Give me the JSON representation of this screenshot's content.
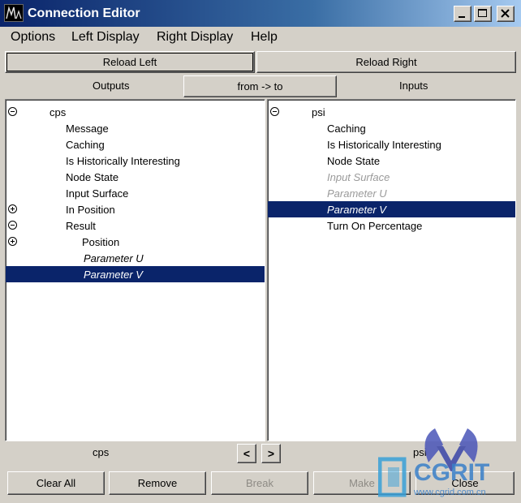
{
  "window": {
    "title": "Connection Editor"
  },
  "menu": {
    "items": [
      "Options",
      "Left Display",
      "Right Display",
      "Help"
    ]
  },
  "reload": {
    "left_label": "Reload Left",
    "right_label": "Reload Right"
  },
  "headers": {
    "outputs": "Outputs",
    "direction": "from -> to",
    "inputs": "Inputs"
  },
  "left_tree": {
    "rows": [
      {
        "label": "cps",
        "expander": "minus",
        "style": "normal",
        "selected": false
      },
      {
        "label": "Message",
        "expander": "none",
        "style": "normal",
        "selected": false
      },
      {
        "label": "Caching",
        "expander": "none",
        "style": "normal",
        "selected": false
      },
      {
        "label": "Is Historically Interesting",
        "expander": "none",
        "style": "normal",
        "selected": false
      },
      {
        "label": "Node State",
        "expander": "none",
        "style": "normal",
        "selected": false
      },
      {
        "label": "Input Surface",
        "expander": "none",
        "style": "normal",
        "selected": false
      },
      {
        "label": "In Position",
        "expander": "plus",
        "style": "normal",
        "selected": false
      },
      {
        "label": "Result",
        "expander": "minus",
        "style": "normal",
        "selected": false
      },
      {
        "label": "Position",
        "expander": "plus",
        "style": "normal",
        "selected": false
      },
      {
        "label": "Parameter U",
        "expander": "none",
        "style": "italic-dark",
        "selected": false
      },
      {
        "label": "Parameter V",
        "expander": "none",
        "style": "italic",
        "selected": true
      }
    ]
  },
  "right_tree": {
    "rows": [
      {
        "label": "psi",
        "expander": "minus",
        "style": "normal",
        "selected": false
      },
      {
        "label": "Caching",
        "expander": "none",
        "style": "normal",
        "selected": false
      },
      {
        "label": "Is Historically Interesting",
        "expander": "none",
        "style": "normal",
        "selected": false
      },
      {
        "label": "Node State",
        "expander": "none",
        "style": "normal",
        "selected": false
      },
      {
        "label": "Input Surface",
        "expander": "none",
        "style": "italic",
        "selected": false
      },
      {
        "label": "Parameter U",
        "expander": "none",
        "style": "italic",
        "selected": false
      },
      {
        "label": "Parameter V",
        "expander": "none",
        "style": "italic",
        "selected": true
      },
      {
        "label": "Turn On Percentage",
        "expander": "none",
        "style": "normal",
        "selected": false
      }
    ]
  },
  "footer": {
    "left_node": "cps",
    "right_node": "psi",
    "prev_arrow": "<",
    "next_arrow": ">"
  },
  "actions": {
    "clear_all": "Clear All",
    "remove": "Remove",
    "break": "Break",
    "make": "Make",
    "close": "Close"
  },
  "watermark": {
    "text": "CGRIT",
    "url": "www.cgrid.com.cn"
  },
  "colors": {
    "selection": "#0a246a",
    "title_gradient_start": "#0a246a",
    "title_gradient_end": "#a6caf0",
    "window_bg": "#d4d0c8"
  },
  "icons": [
    "maya-logo-icon",
    "minimize-icon",
    "maximize-icon",
    "close-icon",
    "expand-minus-icon",
    "expand-plus-icon"
  ]
}
